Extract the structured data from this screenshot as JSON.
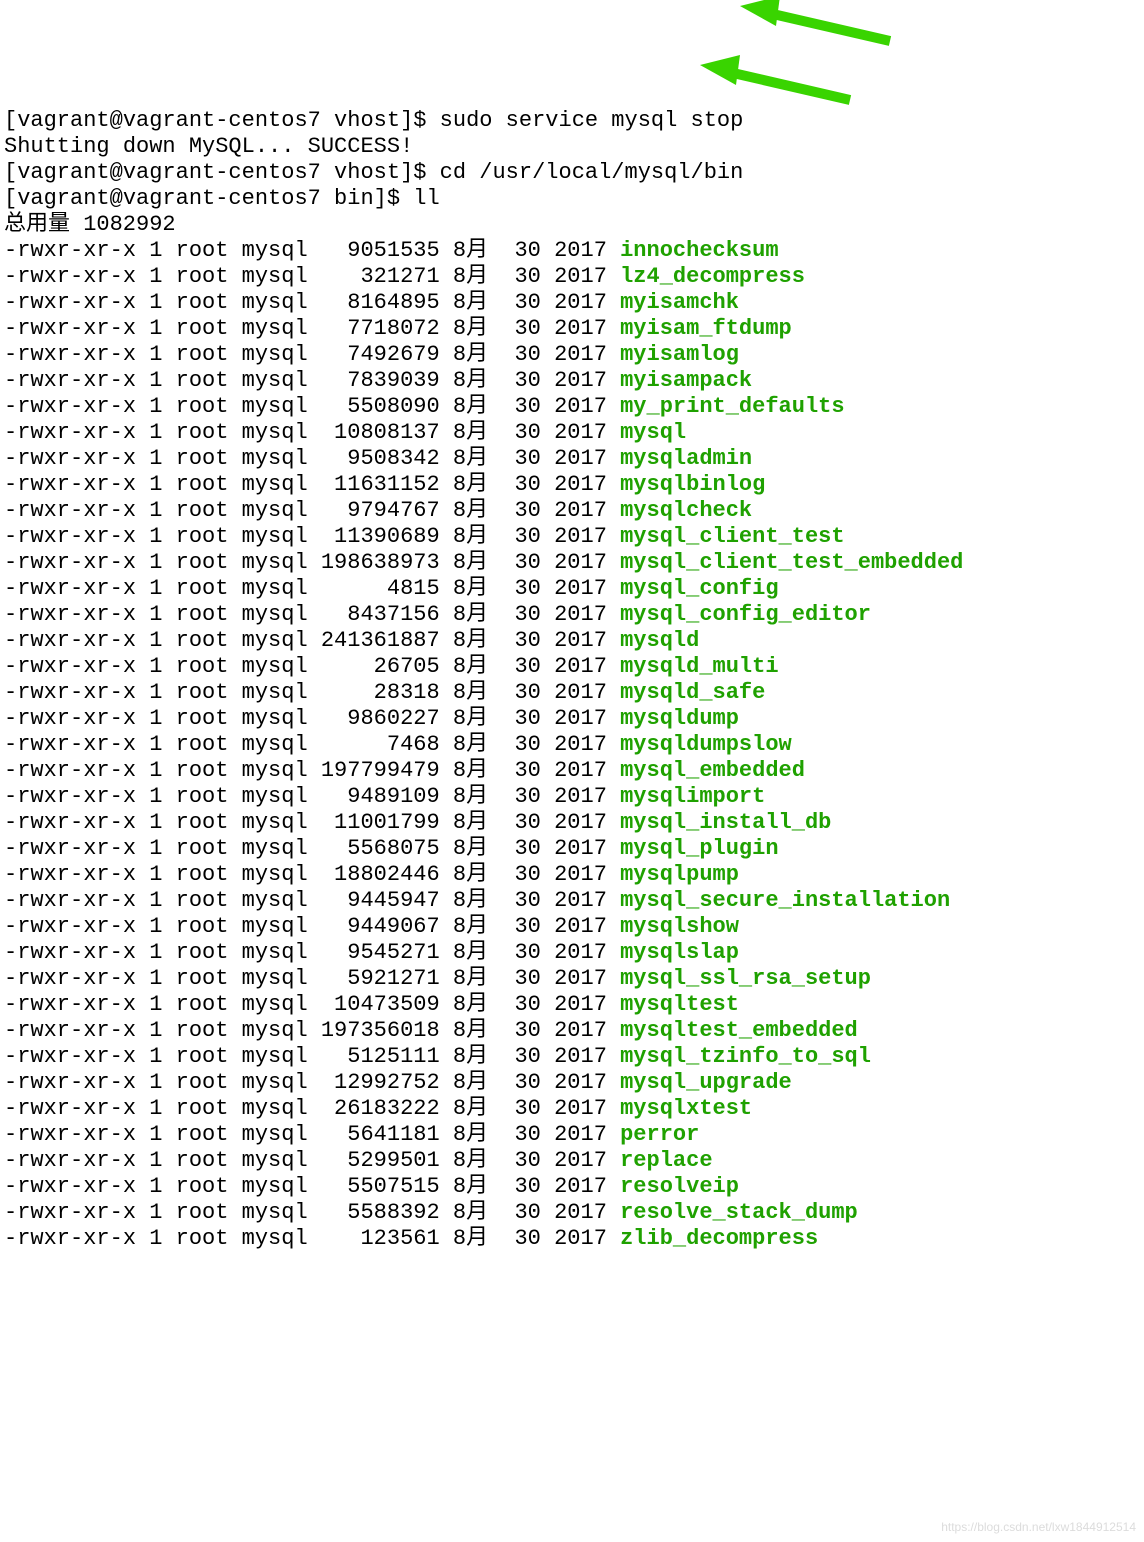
{
  "prompts": [
    {
      "user": "[vagrant@vagrant-centos7 vhost]$ ",
      "cmd": "sudo service mysql stop"
    },
    {
      "text": "Shutting down MySQL... SUCCESS!"
    },
    {
      "user": "[vagrant@vagrant-centos7 vhost]$ ",
      "cmd": "cd /usr/local/mysql/bin"
    },
    {
      "user": "[vagrant@vagrant-centos7 bin]$ ",
      "cmd": "ll"
    }
  ],
  "total_label": "总用量 1082992",
  "columns": {
    "perms": "-rwxr-xr-x",
    "links": "1",
    "owner": "root",
    "group": "mysql",
    "month": "8月",
    "day": "30",
    "year": "2017"
  },
  "files": [
    {
      "size": "9051535",
      "name": "innochecksum"
    },
    {
      "size": "321271",
      "name": "lz4_decompress"
    },
    {
      "size": "8164895",
      "name": "myisamchk"
    },
    {
      "size": "7718072",
      "name": "myisam_ftdump"
    },
    {
      "size": "7492679",
      "name": "myisamlog"
    },
    {
      "size": "7839039",
      "name": "myisampack"
    },
    {
      "size": "5508090",
      "name": "my_print_defaults"
    },
    {
      "size": "10808137",
      "name": "mysql"
    },
    {
      "size": "9508342",
      "name": "mysqladmin"
    },
    {
      "size": "11631152",
      "name": "mysqlbinlog"
    },
    {
      "size": "9794767",
      "name": "mysqlcheck"
    },
    {
      "size": "11390689",
      "name": "mysql_client_test"
    },
    {
      "size": "198638973",
      "name": "mysql_client_test_embedded"
    },
    {
      "size": "4815",
      "name": "mysql_config"
    },
    {
      "size": "8437156",
      "name": "mysql_config_editor"
    },
    {
      "size": "241361887",
      "name": "mysqld"
    },
    {
      "size": "26705",
      "name": "mysqld_multi"
    },
    {
      "size": "28318",
      "name": "mysqld_safe"
    },
    {
      "size": "9860227",
      "name": "mysqldump"
    },
    {
      "size": "7468",
      "name": "mysqldumpslow"
    },
    {
      "size": "197799479",
      "name": "mysql_embedded"
    },
    {
      "size": "9489109",
      "name": "mysqlimport"
    },
    {
      "size": "11001799",
      "name": "mysql_install_db"
    },
    {
      "size": "5568075",
      "name": "mysql_plugin"
    },
    {
      "size": "18802446",
      "name": "mysqlpump"
    },
    {
      "size": "9445947",
      "name": "mysql_secure_installation"
    },
    {
      "size": "9449067",
      "name": "mysqlshow"
    },
    {
      "size": "9545271",
      "name": "mysqlslap"
    },
    {
      "size": "5921271",
      "name": "mysql_ssl_rsa_setup"
    },
    {
      "size": "10473509",
      "name": "mysqltest"
    },
    {
      "size": "197356018",
      "name": "mysqltest_embedded"
    },
    {
      "size": "5125111",
      "name": "mysql_tzinfo_to_sql"
    },
    {
      "size": "12992752",
      "name": "mysql_upgrade"
    },
    {
      "size": "26183222",
      "name": "mysqlxtest"
    },
    {
      "size": "5641181",
      "name": "perror"
    },
    {
      "size": "5299501",
      "name": "replace"
    },
    {
      "size": "5507515",
      "name": "resolveip"
    },
    {
      "size": "5588392",
      "name": "resolve_stack_dump"
    },
    {
      "size": "123561",
      "name": "zlib_decompress"
    }
  ],
  "watermark": "https://blog.csdn.net/lxw1844912514"
}
